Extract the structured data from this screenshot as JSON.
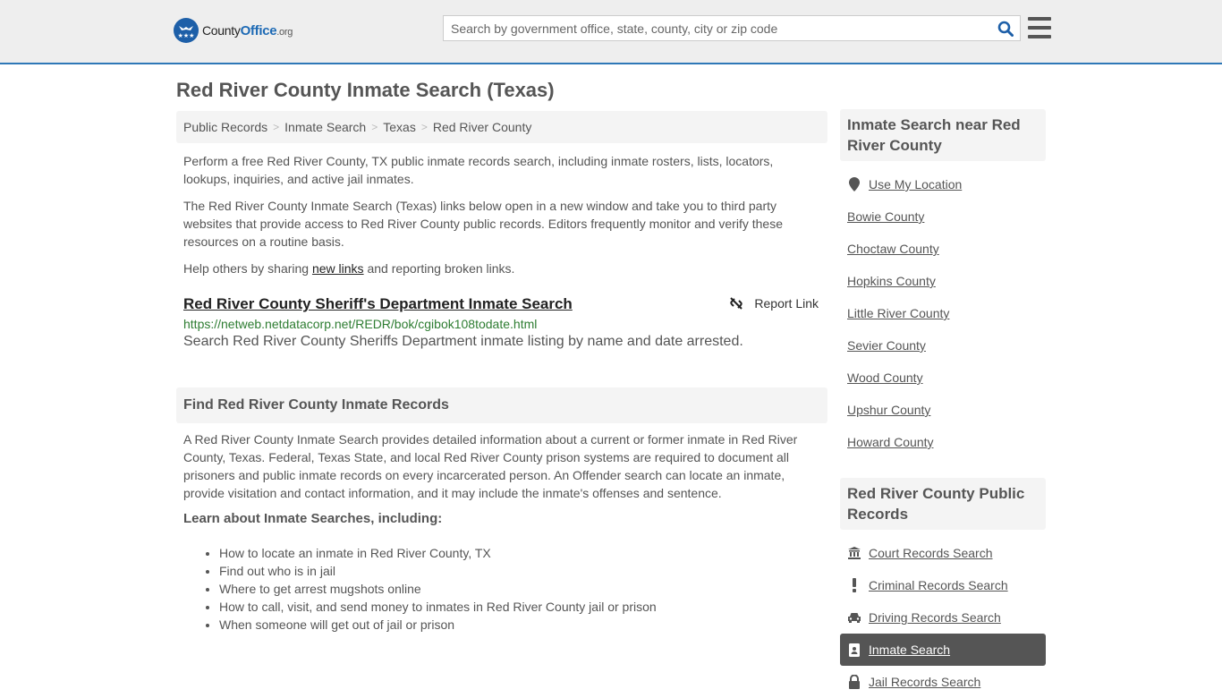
{
  "header": {
    "logo": {
      "prefix": "County",
      "brand": "Office",
      "suffix": ".org"
    },
    "search_placeholder": "Search by government office, state, county, city or zip code",
    "search_value": "",
    "accent_color": "#2e78b7"
  },
  "page_title": "Red River County Inmate Search (Texas)",
  "breadcrumb": [
    "Public Records",
    "Inmate Search",
    "Texas",
    "Red River County"
  ],
  "intro": {
    "p1": "Perform a free Red River County, TX public inmate records search, including inmate rosters, lists, locators, lookups, inquiries, and active jail inmates.",
    "p2": "The Red River County Inmate Search (Texas) links below open in a new window and take you to third party websites that provide access to Red River County public records. Editors frequently monitor and verify these resources on a routine basis.",
    "p3_before": "Help others by sharing ",
    "p3_link": "new links",
    "p3_after": " and reporting broken links."
  },
  "results": [
    {
      "title": "Red River County Sheriff's Department Inmate Search",
      "url": "https://netweb.netdatacorp.net/REDR/bok/cgibok108todate.html",
      "description": "Search Red River County Sheriffs Department inmate listing by name and date arrested.",
      "report_label": "Report Link"
    }
  ],
  "find_section": {
    "heading": "Find Red River County Inmate Records",
    "body": "A Red River County Inmate Search provides detailed information about a current or former inmate in Red River County, Texas. Federal, Texas State, and local Red River County prison systems are required to document all prisoners and public inmate records on every incarcerated person. An Offender search can locate an inmate, provide visitation and contact information, and it may include the inmate's offenses and sentence.",
    "learn_heading": "Learn about Inmate Searches, including:",
    "bullets": [
      "How to locate an inmate in Red River County, TX",
      "Find out who is in jail",
      "Where to get arrest mugshots online",
      "How to call, visit, and send money to inmates in Red River County jail or prison",
      "When someone will get out of jail or prison"
    ]
  },
  "sidebar": {
    "nearby_heading": "Inmate Search near Red River County",
    "nearby": [
      {
        "label": "Use My Location",
        "icon": "map-marker-icon"
      },
      {
        "label": "Bowie County"
      },
      {
        "label": "Choctaw County"
      },
      {
        "label": "Hopkins County"
      },
      {
        "label": "Little River County"
      },
      {
        "label": "Sevier County"
      },
      {
        "label": "Wood County"
      },
      {
        "label": "Upshur County"
      },
      {
        "label": "Howard County"
      }
    ],
    "records_heading": "Red River County Public Records",
    "records": [
      {
        "label": "Court Records Search",
        "icon": "courthouse-icon"
      },
      {
        "label": "Criminal Records Search",
        "icon": "exclamation-icon"
      },
      {
        "label": "Driving Records Search",
        "icon": "car-icon"
      },
      {
        "label": "Inmate Search",
        "icon": "id-badge-icon",
        "active": true
      },
      {
        "label": "Jail Records Search",
        "icon": "lock-icon"
      }
    ]
  }
}
